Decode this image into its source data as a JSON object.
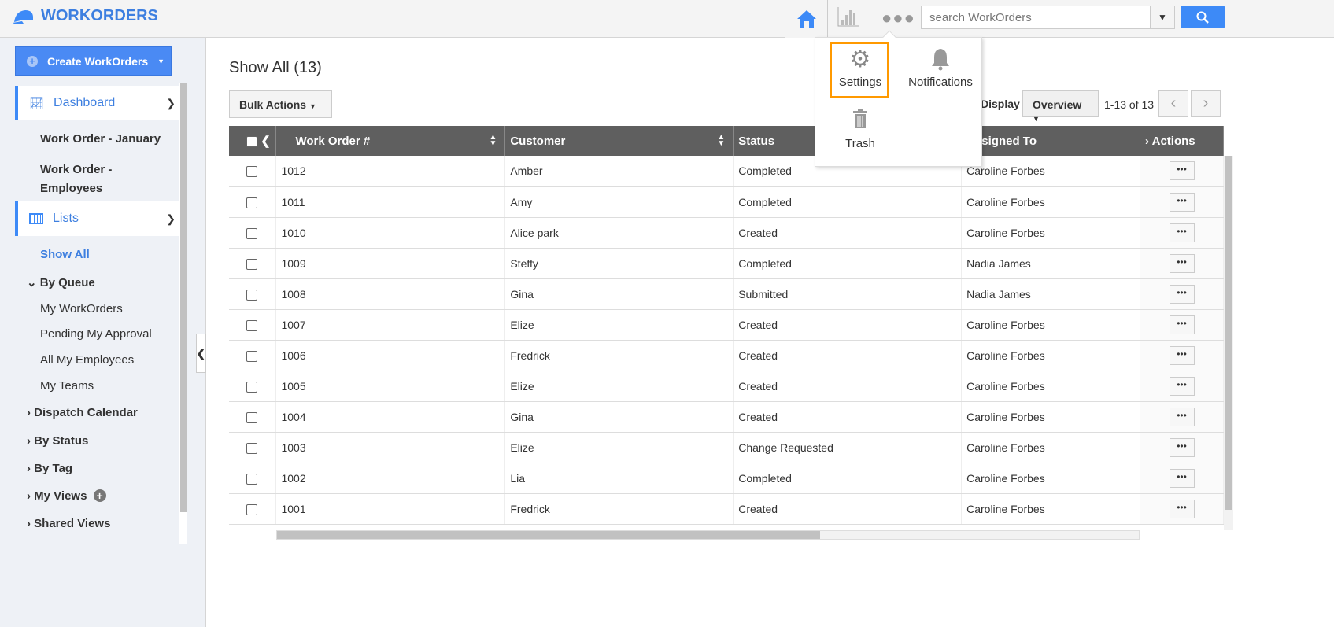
{
  "app": {
    "title": "WORKORDERS",
    "accent": "#3d8af7",
    "highlight": "#ff9900"
  },
  "header": {
    "search_placeholder": "search WorkOrders"
  },
  "sidebar": {
    "create_label": "Create WorkOrders",
    "dashboard": {
      "label": "Dashboard",
      "items": [
        "Work Order - January",
        "Work Order - Employees"
      ]
    },
    "lists": {
      "label": "Lists",
      "show_all": "Show All",
      "by_queue": "By Queue",
      "queue_items": [
        "My WorkOrders",
        "Pending My Approval",
        "All My Employees",
        "My Teams"
      ],
      "groups": [
        "Dispatch Calendar",
        "By Status",
        "By Tag",
        "My Views",
        "Shared Views"
      ]
    }
  },
  "main": {
    "title": "Show All (13)",
    "bulk_label": "Bulk Actions",
    "display_label": "Display",
    "display_value": "Overview",
    "pagination": "1-13 of 13"
  },
  "popover": {
    "settings": "Settings",
    "notifications": "Notifications",
    "trash": "Trash"
  },
  "table": {
    "columns": [
      "Work Order #",
      "Customer",
      "Status",
      "Assigned To",
      "Actions"
    ],
    "rows": [
      [
        "1012",
        "Amber",
        "Completed",
        "Caroline Forbes"
      ],
      [
        "1011",
        "Amy",
        "Completed",
        "Caroline Forbes"
      ],
      [
        "1010",
        "Alice park",
        "Created",
        "Caroline Forbes"
      ],
      [
        "1009",
        "Steffy",
        "Completed",
        "Nadia James"
      ],
      [
        "1008",
        "Gina",
        "Submitted",
        "Nadia James"
      ],
      [
        "1007",
        "Elize",
        "Created",
        "Caroline Forbes"
      ],
      [
        "1006",
        "Fredrick",
        "Created",
        "Caroline Forbes"
      ],
      [
        "1005",
        "Elize",
        "Created",
        "Caroline Forbes"
      ],
      [
        "1004",
        "Gina",
        "Created",
        "Caroline Forbes"
      ],
      [
        "1003",
        "Elize",
        "Change Requested",
        "Caroline Forbes"
      ],
      [
        "1002",
        "Lia",
        "Completed",
        "Caroline Forbes"
      ],
      [
        "1001",
        "Fredrick",
        "Created",
        "Caroline Forbes"
      ]
    ]
  }
}
